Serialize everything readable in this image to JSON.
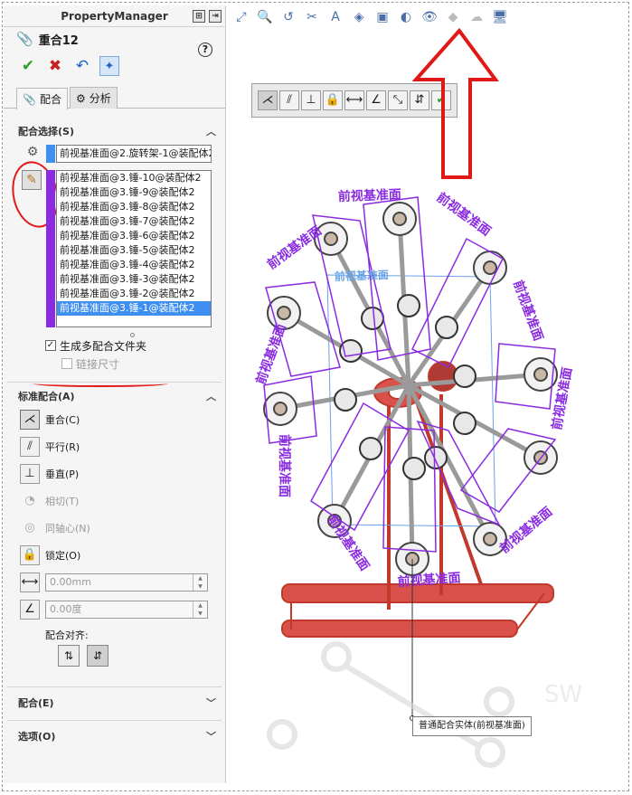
{
  "panel": {
    "header_title": "PropertyManager",
    "feature_title": "重合12",
    "help_label": "?",
    "actions": {
      "ok": "✔",
      "cancel": "✖",
      "undo": "↶",
      "pin": "📌"
    },
    "tabs": [
      {
        "icon": "📎",
        "label": "配合"
      },
      {
        "icon": "⚙",
        "label": "分析"
      }
    ],
    "mate_selections": {
      "title": "配合选择(S)",
      "first_entity": "前视基准面@2.旋转架-1@装配体2",
      "items": [
        "前视基准面@3.锤-10@装配体2",
        "前视基准面@3.锤-9@装配体2",
        "前视基准面@3.锤-8@装配体2",
        "前视基准面@3.锤-7@装配体2",
        "前视基准面@3.锤-6@装配体2",
        "前视基准面@3.锤-5@装配体2",
        "前视基准面@3.锤-4@装配体2",
        "前视基准面@3.锤-3@装配体2",
        "前视基准面@3.锤-2@装配体2",
        "前视基准面@3.锤-1@装配体2"
      ],
      "multi_mate_folder_label": "生成多配合文件夹",
      "link_dimension_label": "链接尺寸"
    },
    "standard_mates": {
      "title": "标准配合(A)",
      "coincident": "重合(C)",
      "parallel": "平行(R)",
      "perpendicular": "垂直(P)",
      "tangent": "相切(T)",
      "concentric": "同轴心(N)",
      "lock": "锁定(O)",
      "distance_value": "0.00mm",
      "angle_value": "0.00度",
      "alignment_label": "配合对齐:"
    },
    "mates_section": "配合(E)",
    "options_section": "选项(O)"
  },
  "graphics": {
    "callout": "普通配合实体(前视基准面)",
    "plane_label": "前视基准面",
    "watermark": "SW"
  },
  "colors": {
    "accent_blue": "#3f8ff0",
    "accent_purple": "#8a2be2",
    "frame_red": "#c0392b",
    "annotation_red": "#e01818"
  }
}
